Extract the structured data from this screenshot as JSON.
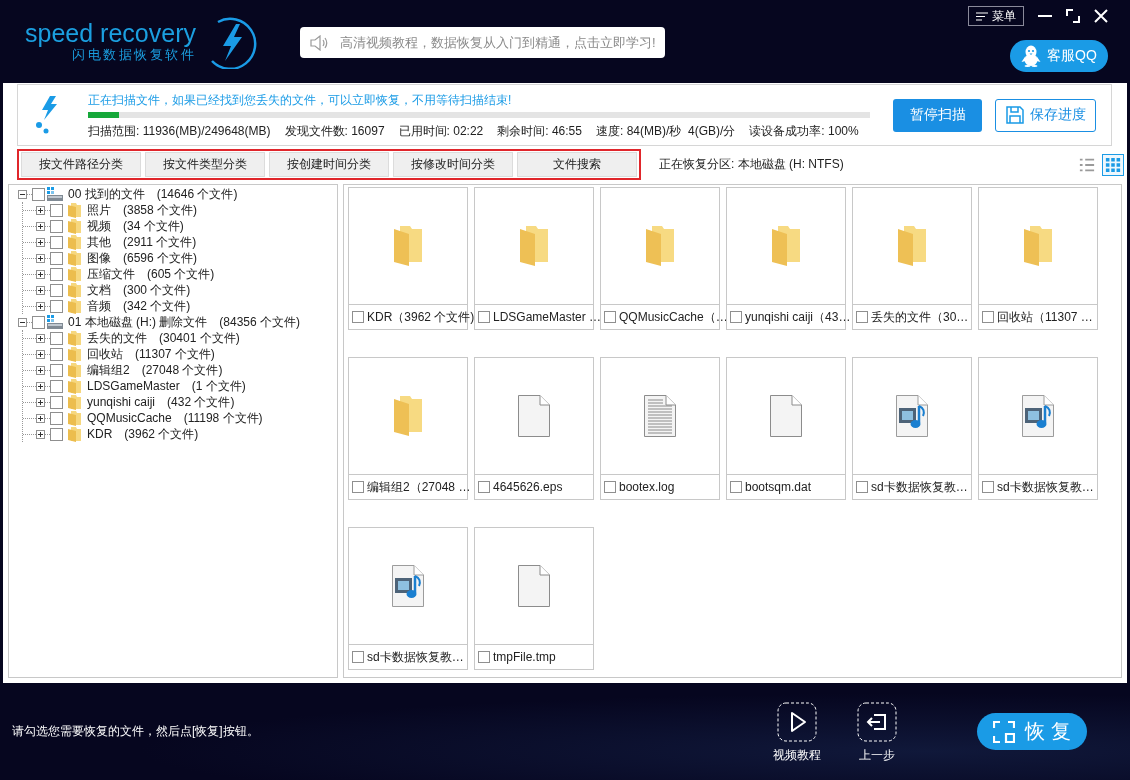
{
  "header": {
    "logo": {
      "name": "speed recovery",
      "subtitle": "闪电数据恢复软件"
    },
    "notice": "高清视频教程，数据恢复从入门到精通，点击立即学习!",
    "menu_button": "菜单",
    "support_button": "客服QQ"
  },
  "scan": {
    "message": "正在扫描文件，如果已经找到您丢失的文件，可以立即恢复，不用等待扫描结束!",
    "progress": {
      "level": 0.04
    },
    "stats": [
      "扫描范围: 11936(MB)/249648(MB)",
      "发现文件数: 16097",
      "已用时间: 02:22",
      "剩余时间: 46:55",
      "速度: 84(MB)/秒  4(GB)/分",
      "读设备成功率: 100%"
    ],
    "buttons": [
      {
        "kind": "primary",
        "label": "暂停扫描"
      },
      {
        "kind": "save",
        "label": "保存进度"
      }
    ]
  },
  "tabs": [
    {
      "label": "按文件路径分类",
      "selected": false
    },
    {
      "label": "按文件类型分类",
      "selected": false
    },
    {
      "label": "按创建时间分类",
      "selected": false
    },
    {
      "label": "按修改时间分类",
      "selected": false
    },
    {
      "label": "文件搜索",
      "selected": false
    }
  ],
  "partition": "正在恢复分区: 本地磁盘 (H: NTFS)",
  "view_toggle": [
    {
      "kind": "list",
      "selected": false
    },
    {
      "kind": "grid",
      "selected": true
    }
  ],
  "tree": [
    {
      "kind": "drive",
      "name": "00 找到的文件",
      "count": "(14646 个文件)",
      "expanded": true,
      "checked": false,
      "children": [
        {
          "kind": "folder",
          "name": "照片",
          "count": "(3858 个文件)",
          "expanded": false,
          "checked": false
        },
        {
          "kind": "folder",
          "name": "视频",
          "count": "(34 个文件)",
          "expanded": false,
          "checked": false
        },
        {
          "kind": "folder",
          "name": "其他",
          "count": "(2911 个文件)",
          "expanded": false,
          "checked": false
        },
        {
          "kind": "folder",
          "name": "图像",
          "count": "(6596 个文件)",
          "expanded": false,
          "checked": false
        },
        {
          "kind": "folder",
          "name": "压缩文件",
          "count": "(605 个文件)",
          "expanded": false,
          "checked": false
        },
        {
          "kind": "folder",
          "name": "文档",
          "count": "(300 个文件)",
          "expanded": false,
          "checked": false
        },
        {
          "kind": "folder",
          "name": "音频",
          "count": "(342 个文件)",
          "expanded": false,
          "checked": false
        }
      ]
    },
    {
      "kind": "drive",
      "name": "01 本地磁盘 (H:) 删除文件",
      "count": "(84356 个文件)",
      "expanded": true,
      "checked": false,
      "children": [
        {
          "kind": "folder",
          "name": "丢失的文件",
          "count": "(30401 个文件)",
          "expanded": false,
          "checked": false
        },
        {
          "kind": "folder",
          "name": "回收站",
          "count": "(11307 个文件)",
          "expanded": false,
          "checked": false
        },
        {
          "kind": "folder",
          "name": "编辑组2",
          "count": "(27048 个文件)",
          "expanded": false,
          "checked": false
        },
        {
          "kind": "folder",
          "name": "LDSGameMaster",
          "count": "(1 个文件)",
          "expanded": false,
          "checked": false
        },
        {
          "kind": "folder",
          "name": "yunqishi caiji",
          "count": "(432 个文件)",
          "expanded": false,
          "checked": false
        },
        {
          "kind": "folder",
          "name": "QQMusicCache",
          "count": "(11198 个文件)",
          "expanded": false,
          "checked": false
        },
        {
          "kind": "folder",
          "name": "KDR",
          "count": "(3962 个文件)",
          "expanded": false,
          "checked": false
        }
      ]
    }
  ],
  "grid": [
    {
      "kind": "folder",
      "label": "KDR（3962 个文件)",
      "checked": false
    },
    {
      "kind": "folder",
      "label": "LDSGameMaster …",
      "checked": false
    },
    {
      "kind": "folder",
      "label": "QQMusicCache（…",
      "checked": false
    },
    {
      "kind": "folder",
      "label": "yunqishi caiji（43…",
      "checked": false
    },
    {
      "kind": "folder",
      "label": "丢失的文件（30…",
      "checked": false
    },
    {
      "kind": "folder",
      "label": "回收站（11307 …",
      "checked": false
    },
    {
      "kind": "folder",
      "label": "编辑组2（27048 …",
      "checked": false
    },
    {
      "kind": "blank",
      "label": "4645626.eps",
      "checked": false
    },
    {
      "kind": "text",
      "label": "bootex.log",
      "checked": false
    },
    {
      "kind": "blank",
      "label": "bootsqm.dat",
      "checked": false
    },
    {
      "kind": "media",
      "label": "sd卡数据恢复教…",
      "checked": false
    },
    {
      "kind": "media",
      "label": "sd卡数据恢复教…",
      "checked": false
    },
    {
      "kind": "media",
      "label": "sd卡数据恢复教…",
      "checked": false
    },
    {
      "kind": "blank",
      "label": "tmpFile.tmp",
      "checked": false
    }
  ],
  "footer": {
    "hint": "请勾选您需要恢复的文件，然后点[恢复]按钮。",
    "actions": [
      {
        "kind": "video",
        "label": "视频教程"
      },
      {
        "kind": "back",
        "label": "上一步"
      }
    ],
    "recover_button": "恢复"
  }
}
